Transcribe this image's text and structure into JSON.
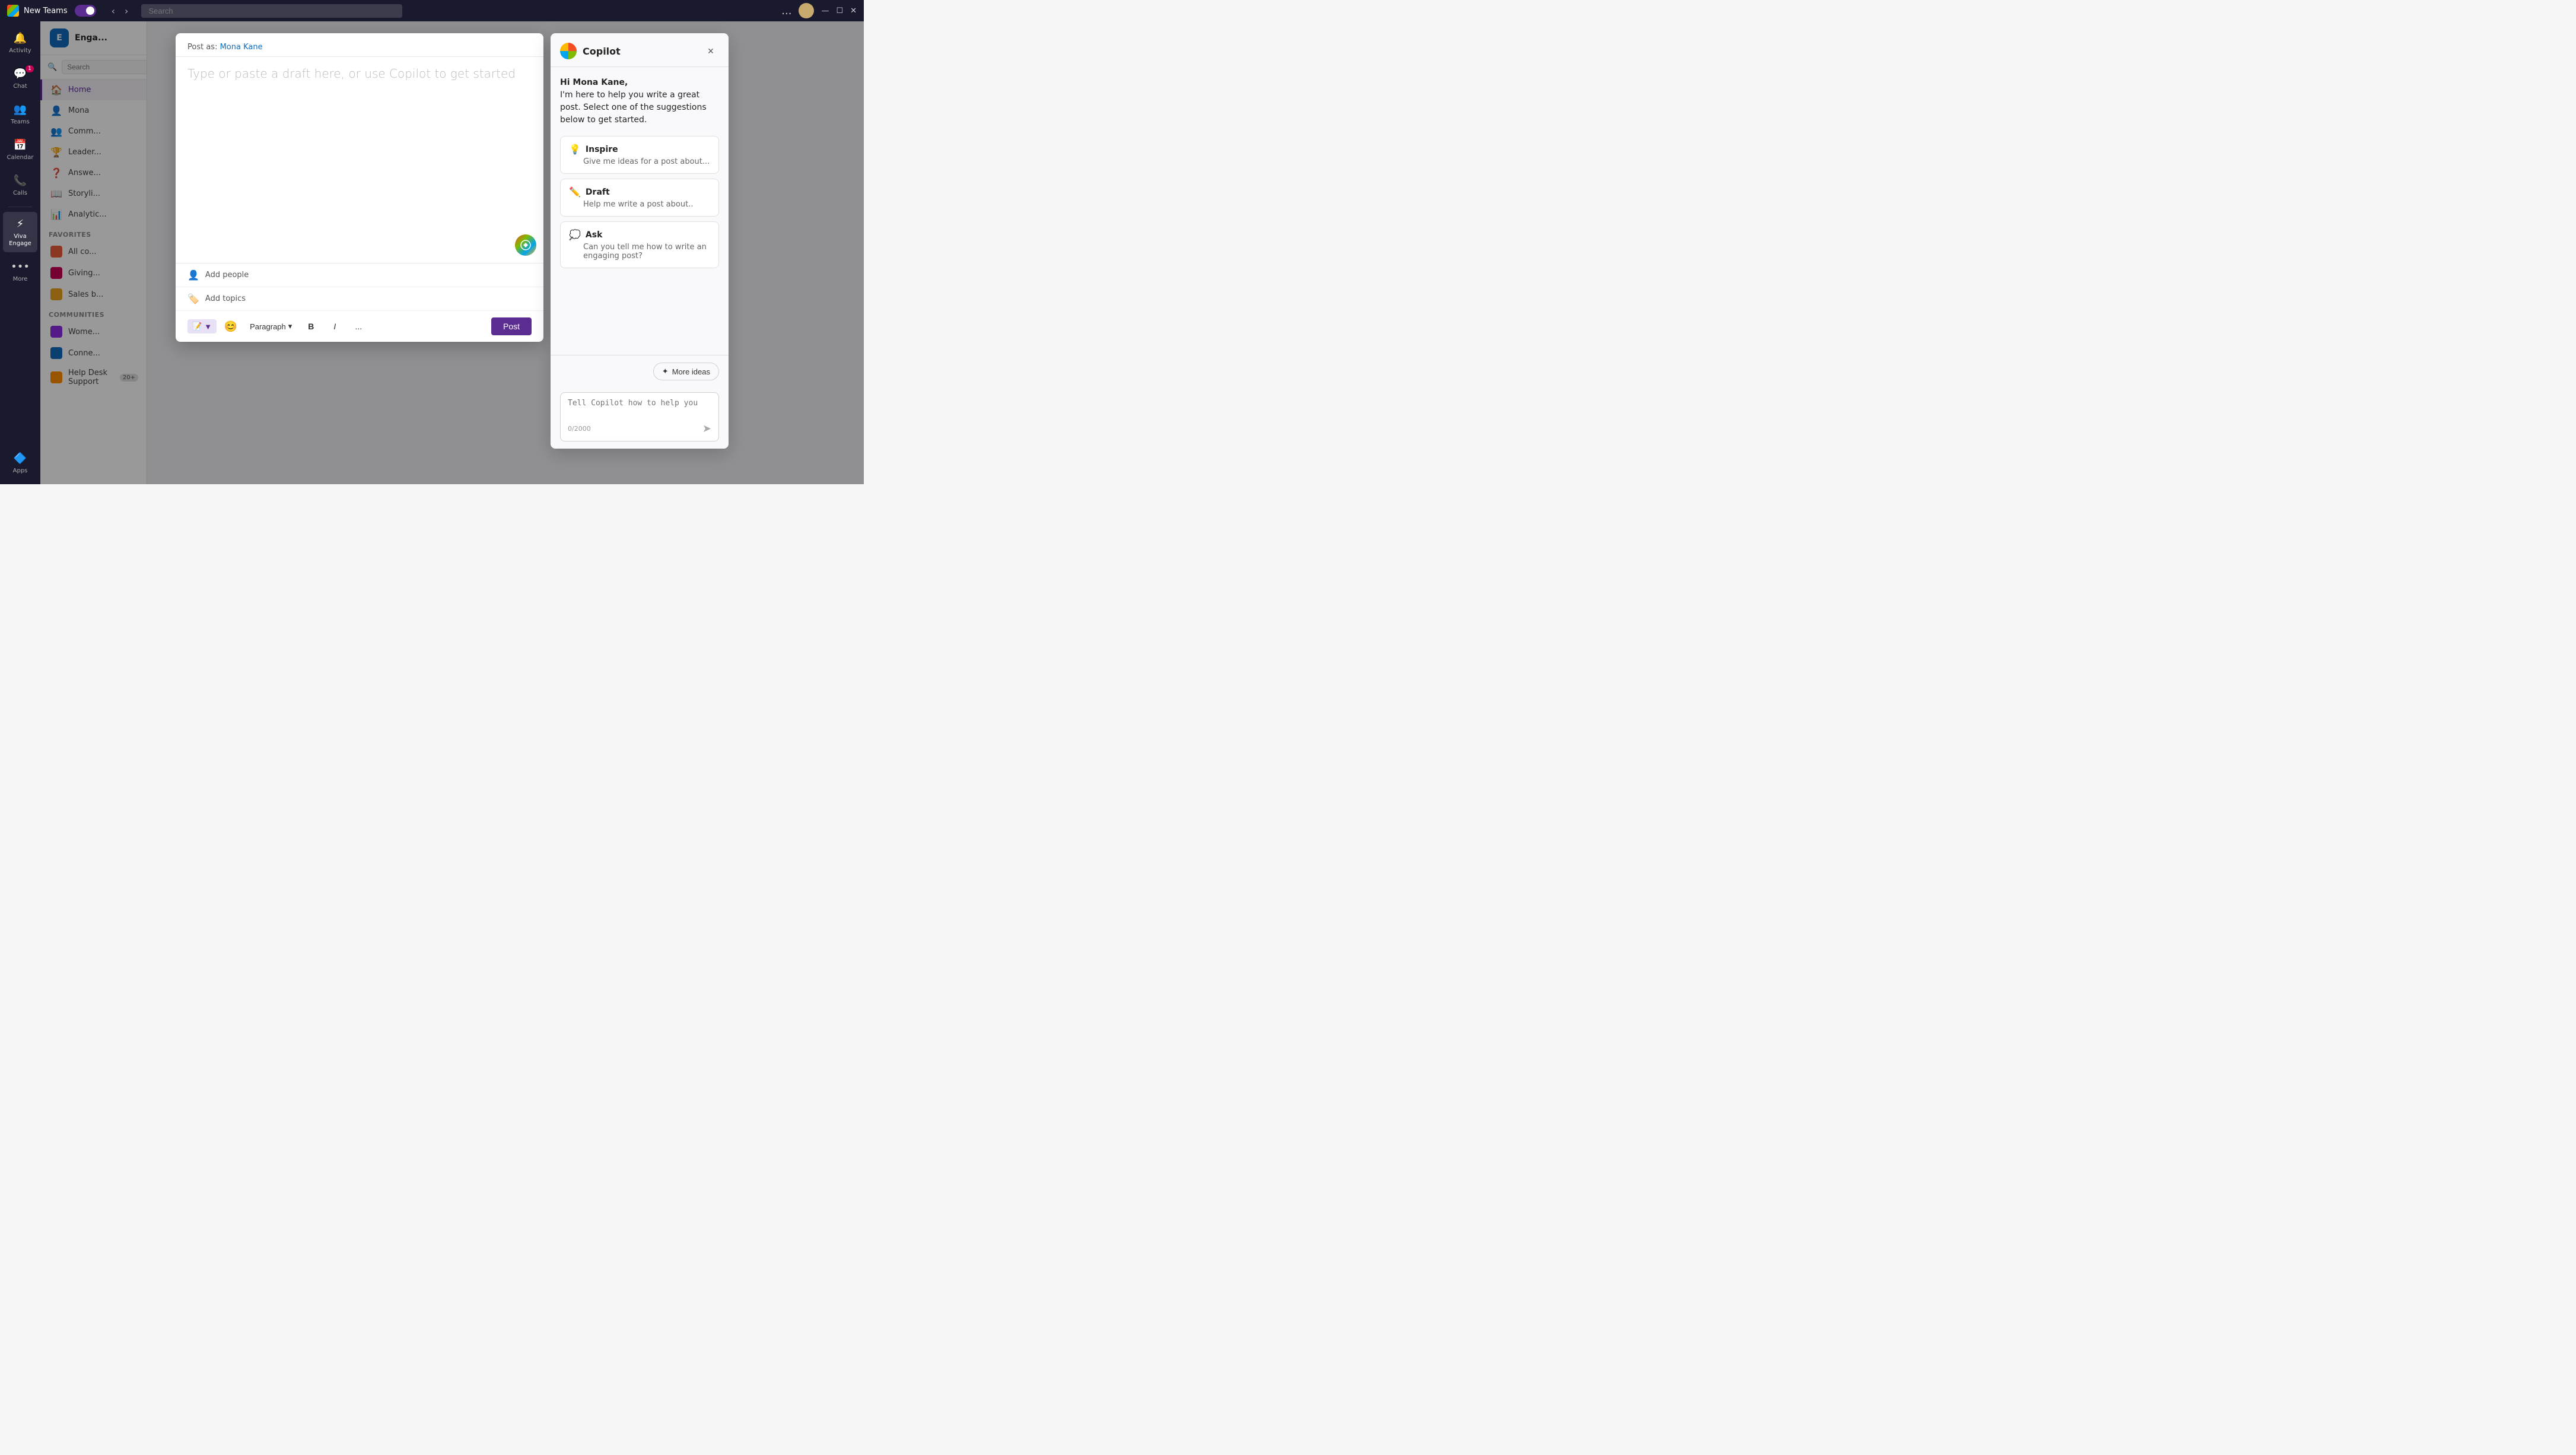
{
  "app": {
    "title": "New Teams",
    "toggle_state": "on"
  },
  "topbar": {
    "search_placeholder": "Search",
    "dots_label": "...",
    "avatar_label": "User avatar"
  },
  "sidebar": {
    "items": [
      {
        "id": "activity",
        "label": "Activity",
        "icon": "🔔",
        "badge": null
      },
      {
        "id": "chat",
        "label": "Chat",
        "icon": "💬",
        "badge": "1"
      },
      {
        "id": "teams",
        "label": "Teams",
        "icon": "👥",
        "badge": null
      },
      {
        "id": "calendar",
        "label": "Calendar",
        "icon": "📅",
        "badge": null
      },
      {
        "id": "calls",
        "label": "Calls",
        "icon": "📞",
        "badge": null
      },
      {
        "id": "viva-engage",
        "label": "Viva Engage",
        "icon": "⚡",
        "badge": null,
        "active": true
      },
      {
        "id": "more",
        "label": "More",
        "icon": "•••",
        "badge": null
      }
    ],
    "bottom_items": [
      {
        "id": "apps",
        "label": "Apps",
        "icon": "🔷"
      }
    ]
  },
  "engage_sidebar": {
    "title": "Enga...",
    "search_placeholder": "Search",
    "nav_items": [
      {
        "id": "home",
        "label": "Home",
        "icon": "🏠",
        "active": true
      },
      {
        "id": "mona",
        "label": "Mona",
        "icon": "👤"
      },
      {
        "id": "communities",
        "label": "Comm...",
        "icon": "👥"
      },
      {
        "id": "leaderboard",
        "label": "Leader...",
        "icon": "🏆"
      },
      {
        "id": "answers",
        "label": "Answe...",
        "icon": "❓"
      },
      {
        "id": "storyline",
        "label": "Storyli...",
        "icon": "📖"
      },
      {
        "id": "analytics",
        "label": "Analytic...",
        "icon": "📊"
      }
    ],
    "favorites_label": "Favorites",
    "favorites": [
      {
        "id": "all-company",
        "label": "All co...",
        "color": "#e85d3a"
      },
      {
        "id": "giving",
        "label": "Giving...",
        "color": "#c30052"
      },
      {
        "id": "sales",
        "label": "Sales b...",
        "color": "#e8a020"
      }
    ],
    "communities_label": "Communities",
    "communities": [
      {
        "id": "women",
        "label": "Wome...",
        "color": "#8a2be2"
      },
      {
        "id": "connect",
        "label": "Conne...",
        "color": "#0f6cbd"
      },
      {
        "id": "helpdesk",
        "label": "Help Desk Support",
        "badge": "20+",
        "color": "#ff8c00"
      }
    ]
  },
  "composer": {
    "post_as_label": "Post as:",
    "post_as_name": "Mona Kane",
    "placeholder": "Type or paste a draft here, or use Copilot to get started",
    "add_people_label": "Add people",
    "add_topics_label": "Add topics",
    "paragraph_label": "Paragraph",
    "bold_label": "B",
    "italic_label": "I",
    "more_label": "...",
    "post_button_label": "Post"
  },
  "copilot": {
    "title": "Copilot",
    "close_label": "×",
    "greeting_name": "Hi Mona Kane,",
    "greeting_body": "I'm here to help you write a great post. Select one of the suggestions below to get started.",
    "suggestions": [
      {
        "id": "inspire",
        "icon": "💡",
        "title": "Inspire",
        "description": "Give me ideas for a post about..."
      },
      {
        "id": "draft",
        "icon": "✏️",
        "title": "Draft",
        "description": "Help me write a post about.."
      },
      {
        "id": "ask",
        "icon": "💭",
        "title": "Ask",
        "description": "Can you tell me how to write an engaging post?"
      }
    ],
    "more_ideas_label": "More ideas",
    "input_placeholder": "Tell Copilot how to help you",
    "char_count": "0/2000"
  }
}
